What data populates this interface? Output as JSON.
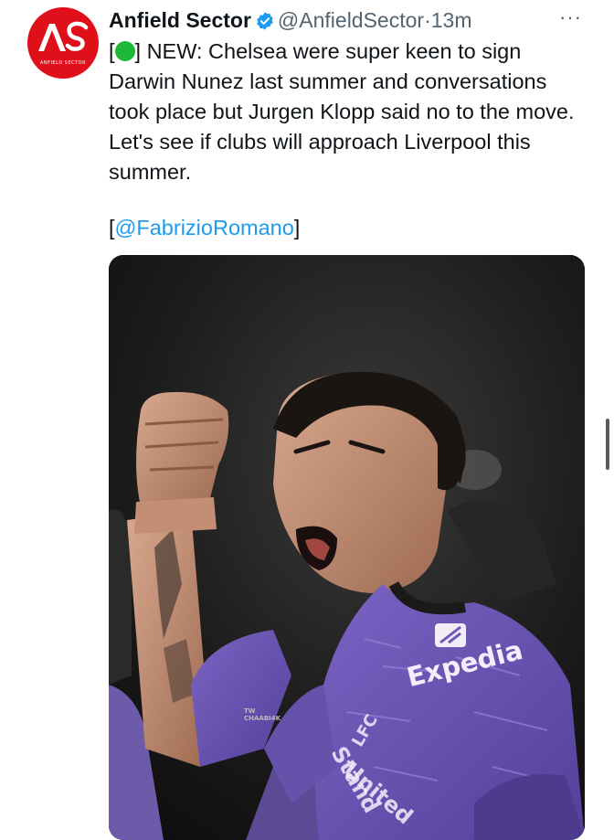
{
  "tweet": {
    "avatar": {
      "initials": "AS",
      "subtext": "ANFIELD SECTOR",
      "color": "#e0101a"
    },
    "author_name": "Anfield Sector",
    "handle": "@AnfieldSector",
    "separator": "·",
    "time": "13m",
    "more_icon": "···",
    "text": {
      "open_bracket": "[",
      "emoji": "green-circle",
      "body": "] NEW: Chelsea were super keen to sign Darwin Nunez last summer and conversations took place but Jurgen Klopp said no to the move. Let's see if clubs will approach Liverpool this summer."
    },
    "source": {
      "open": "[",
      "mention": "@FabrizioRomano",
      "close": "]"
    },
    "media": {
      "description": "photo",
      "watermark_line1": "TW",
      "watermark_line2": "CHAABI4K",
      "sponsor": "Expedia",
      "sleeve_text": "LFC",
      "kit_text_1": "Stand",
      "kit_text_2": "United"
    }
  },
  "colors": {
    "link": "#1d9bf0",
    "verified": "#1d9bf0",
    "kit": "#6f58b8"
  }
}
